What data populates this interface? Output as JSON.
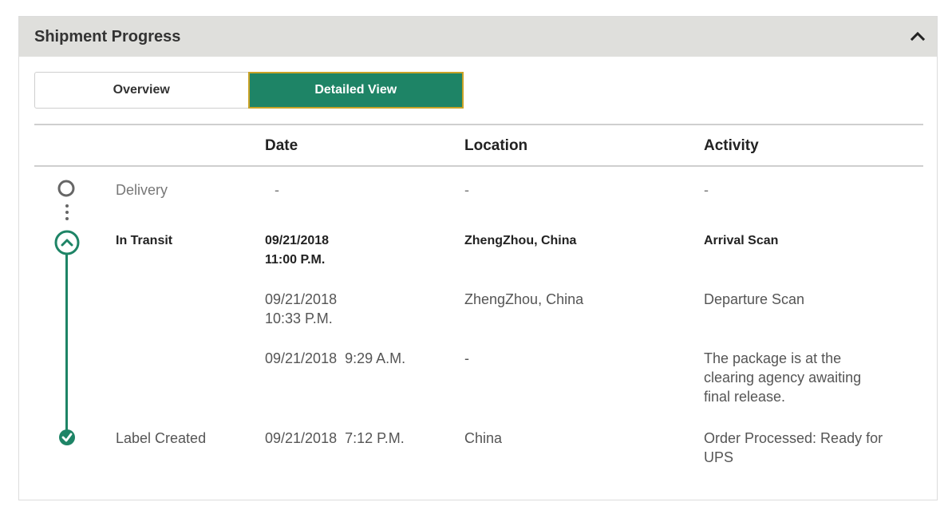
{
  "panel": {
    "title": "Shipment Progress",
    "collapse_icon": "chevron-up-icon"
  },
  "tabs": {
    "overview": "Overview",
    "detailed": "Detailed View",
    "active": "detailed"
  },
  "colors": {
    "accent": "#1e8466",
    "active_border": "#c9a227",
    "header_bg": "#dfdfdc"
  },
  "table": {
    "headers": {
      "date": "Date",
      "location": "Location",
      "activity": "Activity"
    },
    "rows": [
      {
        "status": "Delivery",
        "date_line1": "-",
        "date_line2": "",
        "location": "-",
        "activity": "-",
        "icon": "empty-circle-icon"
      },
      {
        "status": "In Transit",
        "date_line1": "09/21/2018",
        "date_line2": "11:00 P.M.",
        "location": "ZhengZhou, China",
        "activity": "Arrival Scan",
        "icon": "chevron-up-circle-icon"
      },
      {
        "status": "",
        "date_line1": "09/21/2018",
        "date_line2": "10:33 P.M.",
        "location": "ZhengZhou, China",
        "activity": "Departure Scan"
      },
      {
        "status": "",
        "date_line1": "09/21/2018  9:29 A.M.",
        "date_line2": "",
        "location": "-",
        "activity_line1": "The package is at the",
        "activity_line2": "clearing agency awaiting",
        "activity_line3": "final release."
      },
      {
        "status": "Label Created",
        "date_line1": "09/21/2018  7:12 P.M.",
        "date_line2": "",
        "location": "China",
        "activity_line1": "Order Processed: Ready for",
        "activity_line2": "UPS",
        "icon": "check-circle-icon"
      }
    ]
  }
}
